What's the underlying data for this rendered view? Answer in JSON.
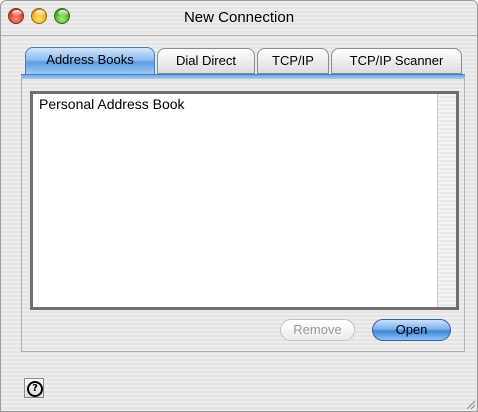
{
  "window": {
    "title": "New Connection"
  },
  "tabs": [
    {
      "label": "Address Books",
      "active": true
    },
    {
      "label": "Dial Direct",
      "active": false
    },
    {
      "label": "TCP/IP",
      "active": false
    },
    {
      "label": "TCP/IP Scanner",
      "active": false
    }
  ],
  "list": {
    "items": [
      "Personal Address Book"
    ]
  },
  "buttons": {
    "remove": "Remove",
    "open": "Open"
  },
  "help": {
    "icon": "help-question-icon",
    "label": "?"
  },
  "colors": {
    "accent": "#5d9ee4",
    "disabled_text": "#9a9a9a"
  }
}
